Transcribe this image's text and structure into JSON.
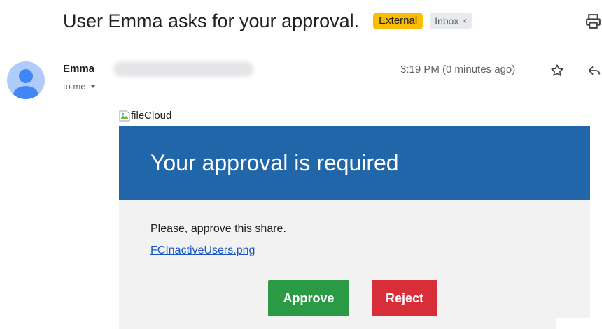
{
  "email": {
    "subject": "User Emma asks for your approval.",
    "labels": {
      "external": "External",
      "inbox": "Inbox",
      "inbox_remove": "×"
    },
    "sender_name": "Emma",
    "recipient_text": "to me",
    "timestamp": "3:19 PM (0 minutes ago)"
  },
  "message": {
    "logo_alt": "fileCloud",
    "banner_title": "Your approval is required",
    "body_text": "Please, approve this share.",
    "file_link": "FCInactiveUsers.png",
    "approve_label": "Approve",
    "reject_label": "Reject"
  },
  "colors": {
    "banner": "#2066a8",
    "approve": "#2b9a45",
    "reject": "#d82e3a",
    "external_badge": "#fbbc04",
    "avatar": "#aecbfa"
  },
  "icons": [
    "print-icon",
    "avatar-person-icon",
    "chevron-down-icon",
    "star-icon",
    "reply-icon",
    "broken-image-icon"
  ]
}
